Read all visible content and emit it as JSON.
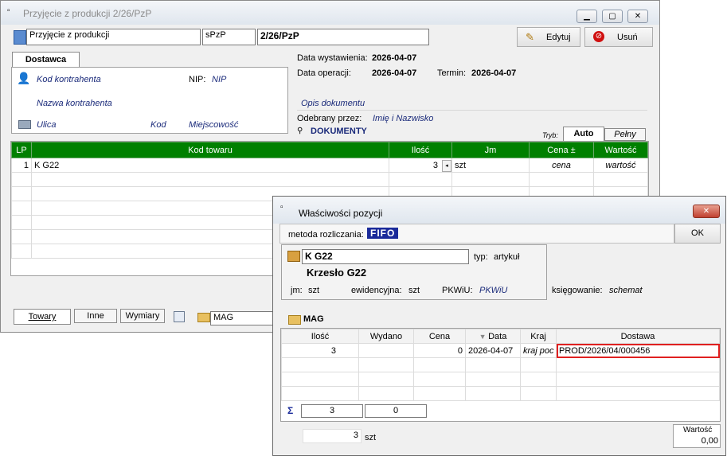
{
  "main_window": {
    "title": "Przyjęcie z produkcji 2/26/PzP",
    "doc_type": "Przyjęcie z produkcji",
    "doc_symbol": "sPzP",
    "doc_number": "2/26/PzP",
    "edit_label": "Edytuj",
    "delete_label": "Usuń",
    "supplier_tab": "Dostawca",
    "supplier_code": "Kod kontrahenta",
    "nip_label": "NIP:",
    "nip_value": "NIP",
    "supplier_name": "Nazwa kontrahenta",
    "street": "Ulica",
    "postal": "Kod",
    "city": "Miejscowość",
    "issue_date_label": "Data wystawienia:",
    "issue_date": "2026-04-07",
    "op_date_label": "Data operacji:",
    "op_date": "2026-04-07",
    "term_label": "Termin:",
    "term_date": "2026-04-07",
    "desc": "Opis dokumentu",
    "received_label": "Odebrany przez:",
    "received_value": "Imię i Nazwisko",
    "documents": "DOKUMENTY",
    "mode_label": "Tryb:",
    "mode_auto": "Auto",
    "mode_full": "Pełny",
    "grid_headers": [
      "LP",
      "Kod towaru",
      "Ilość",
      "Jm",
      "Cena ±",
      "Wartość"
    ],
    "grid_rows": [
      {
        "lp": "1",
        "code": "K G22",
        "qty": "3",
        "unit": "szt",
        "price": "cena",
        "value": "wartość"
      }
    ],
    "bottom_tabs": [
      "Towary",
      "Inne",
      "Wymiary"
    ],
    "warehouse": "MAG"
  },
  "dialog": {
    "title": "Właściwości pozycji",
    "method_label": "metoda rozliczania:",
    "method_value": "FIFO",
    "ok_label": "OK",
    "item_code": "K G22",
    "type_label": "typ:",
    "type_value": "artykuł",
    "item_name": "Krzesło G22",
    "jm_label": "jm:",
    "jm_value": "szt",
    "evid_label": "ewidencyjna:",
    "evid_value": "szt",
    "pkwiu_label": "PKWiU:",
    "pkwiu_value": "PKWiU",
    "booking_label": "księgowanie:",
    "booking_value": "schemat",
    "warehouse": "MAG",
    "headers": [
      "Ilość",
      "Wydano",
      "Cena",
      "Data",
      "Kraj",
      "Dostawa"
    ],
    "rows": [
      {
        "qty": "3",
        "issued": "",
        "price": "0",
        "date": "2026-04-07",
        "country": "kraj poc",
        "delivery": "PROD/2026/04/000456"
      }
    ],
    "sum_symbol": "Σ",
    "sum_qty": "3",
    "sum_issued": "0",
    "footer_qty": "3",
    "footer_unit": "szt",
    "value_label": "Wartość",
    "value": "0,00"
  }
}
